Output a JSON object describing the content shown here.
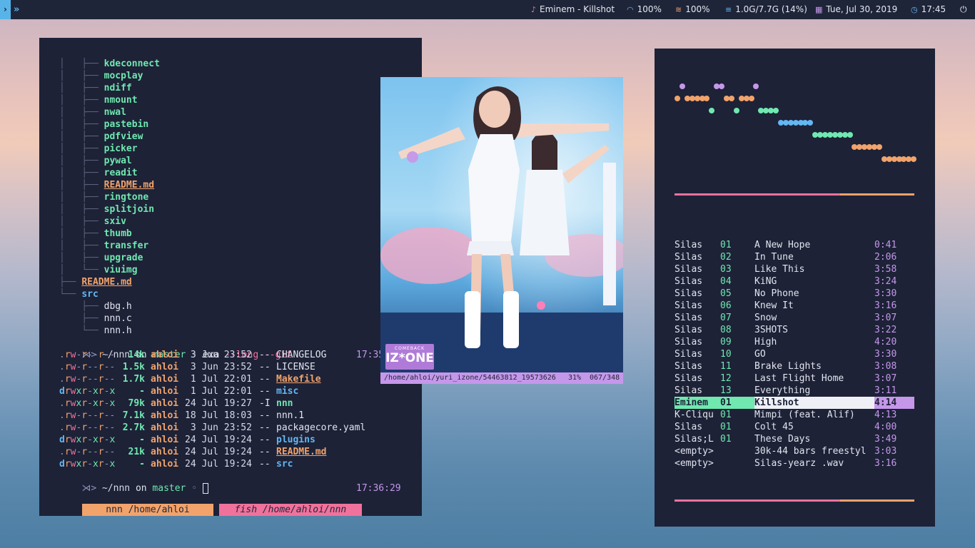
{
  "topbar": {
    "workspace_label": "›",
    "workspace_next": "»",
    "now_playing": "Eminem - Killshot",
    "volume": "100%",
    "wifi": "100%",
    "memory": "1.0G/7.7G (14%)",
    "date": "Tue, Jul 30, 2019",
    "time": "17:45",
    "power_icon": "power-icon"
  },
  "terminal": {
    "tree": [
      {
        "prefix": "│   ├── ",
        "name": "kdeconnect",
        "type": "dir"
      },
      {
        "prefix": "│   ├── ",
        "name": "mocplay",
        "type": "dir"
      },
      {
        "prefix": "│   ├── ",
        "name": "ndiff",
        "type": "dir"
      },
      {
        "prefix": "│   ├── ",
        "name": "nmount",
        "type": "dir"
      },
      {
        "prefix": "│   ├── ",
        "name": "nwal",
        "type": "dir"
      },
      {
        "prefix": "│   ├── ",
        "name": "pastebin",
        "type": "dir"
      },
      {
        "prefix": "│   ├── ",
        "name": "pdfview",
        "type": "dir"
      },
      {
        "prefix": "│   ├── ",
        "name": "picker",
        "type": "dir"
      },
      {
        "prefix": "│   ├── ",
        "name": "pywal",
        "type": "dir"
      },
      {
        "prefix": "│   ├── ",
        "name": "readit",
        "type": "dir"
      },
      {
        "prefix": "│   ├── ",
        "name": "README.md",
        "type": "md"
      },
      {
        "prefix": "│   ├── ",
        "name": "ringtone",
        "type": "dir"
      },
      {
        "prefix": "│   ├── ",
        "name": "splitjoin",
        "type": "dir"
      },
      {
        "prefix": "│   ├── ",
        "name": "sxiv",
        "type": "dir"
      },
      {
        "prefix": "│   ├── ",
        "name": "thumb",
        "type": "dir"
      },
      {
        "prefix": "│   ├── ",
        "name": "transfer",
        "type": "dir"
      },
      {
        "prefix": "│   ├── ",
        "name": "upgrade",
        "type": "dir"
      },
      {
        "prefix": "│   └── ",
        "name": "viuimg",
        "type": "dir"
      },
      {
        "prefix": "├── ",
        "name": "README.md",
        "type": "md"
      },
      {
        "prefix": "└── ",
        "name": "src",
        "type": "blu"
      },
      {
        "prefix": "    ├── ",
        "name": "dbg.h",
        "type": "plain"
      },
      {
        "prefix": "    ├── ",
        "name": "nnn.c",
        "type": "plain"
      },
      {
        "prefix": "    └── ",
        "name": "nnn.h",
        "type": "plain"
      }
    ],
    "prompt1": {
      "symbol": "⋊>",
      "path": "~/nnn",
      "on": "on",
      "branch": "master",
      "sep": "◦",
      "cmd": "exa",
      "args": "--long --git",
      "time": "17:35"
    },
    "listing": [
      {
        "perms": ".rw-r--r--",
        "size": "14k",
        "user": "ahloi",
        "date": " 3 Jun 23:52",
        "git": "--",
        "name": "CHANGELOG",
        "type": "plain"
      },
      {
        "perms": ".rw-r--r--",
        "size": "1.5k",
        "user": "ahloi",
        "date": " 3 Jun 23:52",
        "git": "--",
        "name": "LICENSE",
        "type": "plain"
      },
      {
        "perms": ".rw-r--r--",
        "size": "1.7k",
        "user": "ahloi",
        "date": " 1 Jul 22:01",
        "git": "--",
        "name": "Makefile",
        "type": "md"
      },
      {
        "perms": "drwxr-xr-x",
        "size": "-",
        "user": "ahloi",
        "date": " 1 Jul 22:01",
        "git": "--",
        "name": "misc",
        "type": "blu"
      },
      {
        "perms": ".rwxr-xr-x",
        "size": "79k",
        "user": "ahloi",
        "date": "24 Jul 19:27",
        "git": "-I",
        "name": "nnn",
        "type": "dir"
      },
      {
        "perms": ".rw-r--r--",
        "size": "7.1k",
        "user": "ahloi",
        "date": "18 Jul 18:03",
        "git": "--",
        "name": "nnn.1",
        "type": "plain"
      },
      {
        "perms": ".rw-r--r--",
        "size": "2.7k",
        "user": "ahloi",
        "date": " 3 Jun 23:52",
        "git": "--",
        "name": "packagecore.yaml",
        "type": "plain"
      },
      {
        "perms": "drwxr-xr-x",
        "size": "-",
        "user": "ahloi",
        "date": "24 Jul 19:24",
        "git": "--",
        "name": "plugins",
        "type": "blu"
      },
      {
        "perms": ".rw-r--r--",
        "size": "21k",
        "user": "ahloi",
        "date": "24 Jul 19:24",
        "git": "--",
        "name": "README.md",
        "type": "md"
      },
      {
        "perms": "drwxr-xr-x",
        "size": "-",
        "user": "ahloi",
        "date": "24 Jul 19:24",
        "git": "--",
        "name": "src",
        "type": "blu"
      }
    ],
    "prompt2": {
      "symbol": "⋊>",
      "path": "~/nnn",
      "on": "on",
      "branch": "master",
      "sep": "◦",
      "time": "17:36:29"
    },
    "tabs": [
      {
        "label": "nnn /home/ahloi",
        "color": "#f1a36b"
      },
      {
        "label": "fish /home/ahloi/nnn",
        "color": "#f0729c"
      }
    ]
  },
  "viewer": {
    "path": "/home/ahloi/yuri_izone/54463812_19573626",
    "zoom": "31%",
    "index": "067/348",
    "logo_top": "COMEBACK",
    "logo_main": "IZ*ONE"
  },
  "visualizer": {
    "colors": [
      "#c597ea",
      "#f1a36b",
      "#70e8b0",
      "#63b7f2",
      "#70e8b0",
      "#f1a36b"
    ],
    "levels": [
      4,
      5,
      4,
      4,
      4,
      4,
      4,
      3,
      5,
      5,
      4,
      4,
      3,
      4,
      4,
      4,
      5,
      3,
      3,
      3,
      3,
      2,
      2,
      2,
      2,
      2,
      2,
      2,
      1,
      1,
      1,
      1,
      1,
      1,
      1,
      1,
      0,
      0,
      0,
      0,
      0,
      0,
      -1,
      -1,
      -1,
      -1,
      -1,
      -1,
      -1
    ]
  },
  "progress": {
    "fraction": 0.69,
    "played_color": "#f0729c",
    "remaining_color": "#f1a36b"
  },
  "playlist": [
    {
      "artist": "Silas",
      "track": "01",
      "title": "A New Hope",
      "duration": "0:41"
    },
    {
      "artist": "Silas",
      "track": "02",
      "title": "In Tune",
      "duration": "2:06"
    },
    {
      "artist": "Silas",
      "track": "03",
      "title": "Like This",
      "duration": "3:58"
    },
    {
      "artist": "Silas",
      "track": "04",
      "title": "KiNG",
      "duration": "3:24"
    },
    {
      "artist": "Silas",
      "track": "05",
      "title": "No Phone",
      "duration": "3:30"
    },
    {
      "artist": "Silas",
      "track": "06",
      "title": "Knew It",
      "duration": "3:16"
    },
    {
      "artist": "Silas",
      "track": "07",
      "title": "Snow",
      "duration": "3:07"
    },
    {
      "artist": "Silas",
      "track": "08",
      "title": "3SHOTS",
      "duration": "3:22"
    },
    {
      "artist": "Silas",
      "track": "09",
      "title": "High",
      "duration": "4:20"
    },
    {
      "artist": "Silas",
      "track": "10",
      "title": "GO",
      "duration": "3:30"
    },
    {
      "artist": "Silas",
      "track": "11",
      "title": "Brake Lights",
      "duration": "3:08"
    },
    {
      "artist": "Silas",
      "track": "12",
      "title": "Last Flight Home",
      "duration": "3:07"
    },
    {
      "artist": "Silas",
      "track": "13",
      "title": "Everything",
      "duration": "3:11"
    },
    {
      "artist": "Eminem",
      "track": "01",
      "title": "Killshot",
      "duration": "4:14",
      "active": true
    },
    {
      "artist": "K-Cliqu",
      "track": "01",
      "title": "Mimpi (feat. Alif)",
      "duration": "4:13"
    },
    {
      "artist": "Silas",
      "track": "01",
      "title": "Colt 45",
      "duration": "4:00"
    },
    {
      "artist": "Silas;L",
      "track": "01",
      "title": "These Days",
      "duration": "3:49"
    },
    {
      "artist": "<empty>",
      "track": "",
      "title": "30k-44 bars freestyl",
      "duration": "3:03"
    },
    {
      "artist": "<empty>",
      "track": "",
      "title": "Silas-yearz .wav",
      "duration": "3:16"
    }
  ]
}
